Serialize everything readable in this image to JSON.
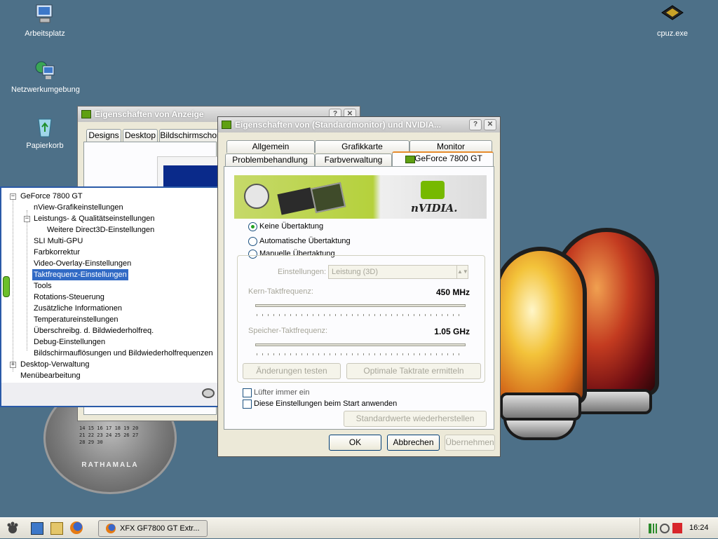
{
  "desktop": {
    "icons": [
      {
        "label": "Arbeitsplatz",
        "icon": "my-computer-icon"
      },
      {
        "label": "Netzwerkumgebung",
        "icon": "network-places-icon"
      },
      {
        "label": "Papierkorb",
        "icon": "recycle-bin-icon"
      },
      {
        "label": "cpuz.exe",
        "icon": "cpu-chip-icon"
      }
    ],
    "clock_widget": {
      "calendar_rows": [
        "14 15 16 17 18 19 20",
        "21 22 23 24 25 26 27",
        "28 29 30"
      ],
      "brand": "RATHAMALA"
    }
  },
  "display_props": {
    "title": "Eigenschaften von Anzeige",
    "tabs": [
      "Designs",
      "Desktop",
      "Bildschirmschon"
    ]
  },
  "monitor_props": {
    "title": "Eigenschaften von (Standardmonitor) und NVIDIA...",
    "tabs_row1": [
      "Allgemein",
      "Grafikkarte",
      "Monitor"
    ],
    "tabs_row2": [
      "Problembehandlung",
      "Farbverwaltung",
      "GeForce 7800 GT"
    ],
    "banner_brand": "nVIDIA.",
    "radio_options": [
      {
        "label": "Keine Übertaktung",
        "selected": true
      },
      {
        "label": "Automatische Übertaktung",
        "selected": false
      },
      {
        "label": "Manuelle Übertaktung",
        "selected": false
      }
    ],
    "settings_label": "Einstellungen:",
    "settings_value": "Leistung (3D)",
    "core_label": "Kern-Taktfrequenz:",
    "core_value": "450 MHz",
    "mem_label": "Speicher-Taktfrequenz:",
    "mem_value": "1.05 GHz",
    "btn_test": "Änderungen testen",
    "btn_optimal": "Optimale Taktrate ermitteln",
    "check_fan": "Lüfter immer ein",
    "check_startup": "Diese Einstellungen beim Start anwenden",
    "btn_defaults": "Standardwerte wiederherstellen",
    "btn_ok": "OK",
    "btn_cancel": "Abbrechen",
    "btn_apply": "Übernehmen",
    "help_glyph": "?",
    "close_glyph": "✕"
  },
  "tree": {
    "items": [
      {
        "label": "GeForce 7800 GT",
        "level": 0,
        "expander": "−"
      },
      {
        "label": "nView-Grafikeinstellungen",
        "level": 1
      },
      {
        "label": "Leistungs- & Qualitätseinstellungen",
        "level": 1,
        "expander": "−"
      },
      {
        "label": "Weitere Direct3D-Einstellungen",
        "level": 2
      },
      {
        "label": "SLI Multi-GPU",
        "level": 1
      },
      {
        "label": "Farbkorrektur",
        "level": 1
      },
      {
        "label": "Video-Overlay-Einstellungen",
        "level": 1
      },
      {
        "label": "Taktfrequenz-Einstellungen",
        "level": 1,
        "selected": true
      },
      {
        "label": "Tools",
        "level": 1
      },
      {
        "label": "Rotations-Steuerung",
        "level": 1
      },
      {
        "label": "Zusätzliche Informationen",
        "level": 1
      },
      {
        "label": "Temperatureinstellungen",
        "level": 1
      },
      {
        "label": "Überschreibg. d. Bildwiederholfreq.",
        "level": 1
      },
      {
        "label": "Debug-Einstellungen",
        "level": 1
      },
      {
        "label": "Bildschirmauflösungen und Bildwiederholfrequenzen",
        "level": 1
      },
      {
        "label": "Desktop-Verwaltung",
        "level": 0,
        "expander": "+"
      },
      {
        "label": "Menübearbeitung",
        "level": 0
      }
    ]
  },
  "taskbar": {
    "task_label": "XFX GF7800 GT Extr...",
    "clock": "16:24",
    "quicklaunch": [
      "start-icon",
      "desktop-icon",
      "folder-icon",
      "firefox-icon"
    ]
  },
  "colors": {
    "desktop_bg": "#4d7088",
    "selection": "#316ac5",
    "nvidia_green": "#76b900"
  }
}
